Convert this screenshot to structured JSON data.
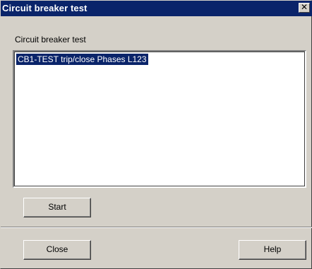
{
  "window": {
    "title": "Circuit breaker test",
    "close_glyph": "✕"
  },
  "group": {
    "label": "Circuit breaker test"
  },
  "list": {
    "items": [
      {
        "label": "CB1-TEST trip/close  Phases L123",
        "selected": true
      }
    ]
  },
  "buttons": {
    "start": "Start",
    "close": "Close",
    "help": "Help"
  },
  "colors": {
    "title_bar": "#0a246a",
    "dialog_face": "#d4d0c8",
    "selection": "#0a246a"
  }
}
